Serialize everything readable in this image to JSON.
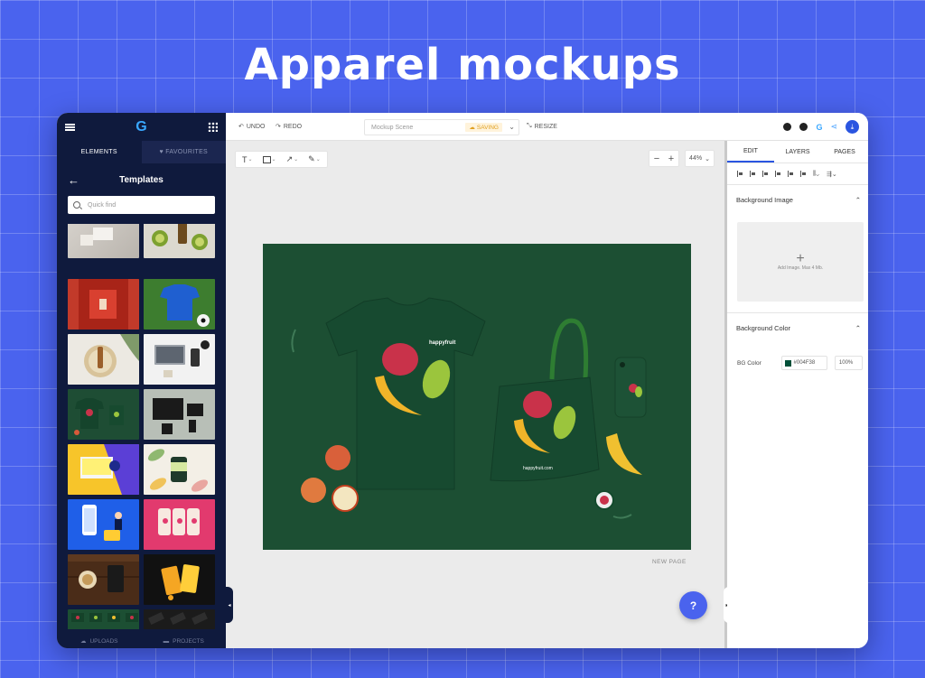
{
  "headline": "Apparel mockups",
  "left_panel": {
    "logo": "G",
    "tabs": [
      "ELEMENTS",
      "FAVOURITES"
    ],
    "title": "Templates",
    "search_placeholder": "Quick find",
    "bottom": [
      "UPLOADS",
      "PROJECTS"
    ]
  },
  "topbar": {
    "undo": "UNDO",
    "redo": "REDO",
    "scene_name": "Mockup Scene",
    "saving": "SAVING",
    "resize": "RESIZE",
    "brand_g": "G"
  },
  "tools": {
    "text": "T"
  },
  "zoom": {
    "minus": "−",
    "plus": "+",
    "value": "44%"
  },
  "canvas": {
    "background_color": "#1c4f33",
    "tshirt_label": "happyfruit",
    "bag_label": "happyfruit.com",
    "new_page": "NEW PAGE",
    "help": "?"
  },
  "right_panel": {
    "tabs": [
      "EDIT",
      "LAYERS",
      "PAGES"
    ],
    "background_image_title": "Background Image",
    "upload_hint": "Add Image. Max 4 Mb.",
    "background_color_title": "Background Color",
    "bg_color_label": "BG Color",
    "bg_color_value": "#004F38",
    "opacity": "100%"
  },
  "colors": {
    "accent": "#2a55e0",
    "panel_dark": "#0f1a3d",
    "page_bg": "#4a63ee"
  }
}
